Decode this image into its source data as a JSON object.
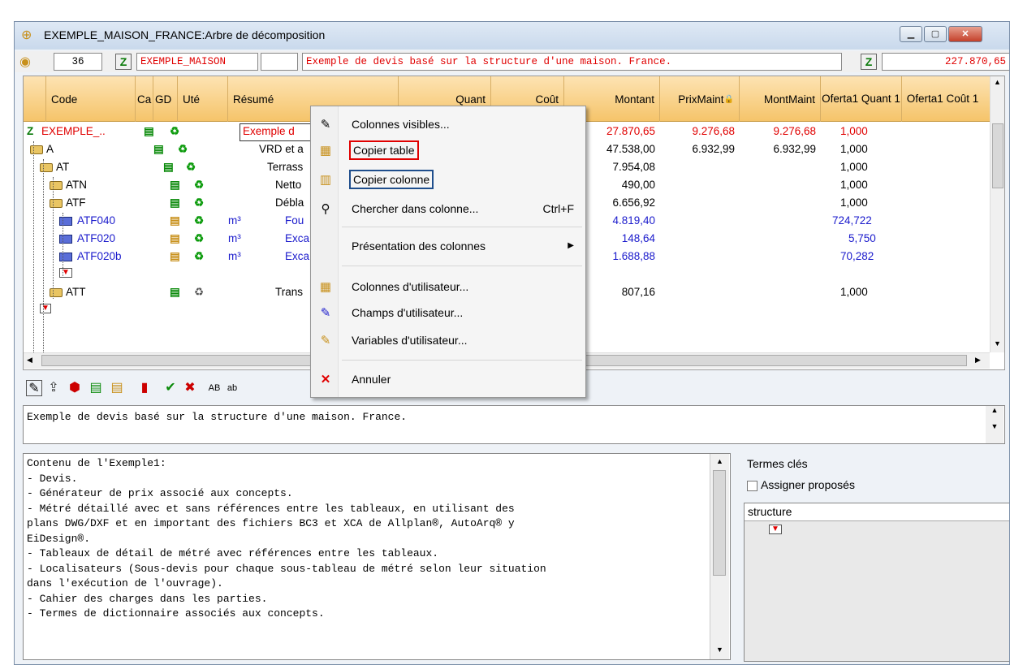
{
  "window": {
    "title": "EXEMPLE_MAISON_FRANCE:Arbre de décomposition",
    "min_label": "▁",
    "max_label": "▢",
    "close_label": "✕"
  },
  "topbar": {
    "count": "36",
    "code": "EXEMPLE_MAISON",
    "summary": "Exemple de devis basé sur la structure d'une maison. France.",
    "total": "227.870,65"
  },
  "grid": {
    "headers": {
      "code": "Code",
      "ca": "Ca",
      "gd": "GD",
      "ute": "Uté",
      "resume": "Résumé",
      "quant": "Quant",
      "cout": "Coût",
      "montant": "Montant",
      "prixmaint": "PrixMaint",
      "montmaint": "MontMaint",
      "oferta_quant": "Oferta1 Quant 1",
      "oferta_cout": "Oferta1 Coût 1"
    },
    "rows": [
      {
        "code": "EXEMPLE_..",
        "ute": "",
        "resume": "Exemple d",
        "montant": "27.870,65",
        "prixmaint": "9.276,68",
        "montmaint": "9.276,68",
        "oferta": "1,000"
      },
      {
        "code": "A",
        "ute": "",
        "resume": "VRD et a",
        "montant": "47.538,00",
        "prixmaint": "6.932,99",
        "montmaint": "6.932,99",
        "oferta": "1,000"
      },
      {
        "code": "AT",
        "ute": "",
        "resume": "Terrass",
        "montant": "7.954,08",
        "prixmaint": "",
        "montmaint": "",
        "oferta": "1,000"
      },
      {
        "code": "ATN",
        "ute": "",
        "resume": "Netto",
        "montant": "490,00",
        "prixmaint": "",
        "montmaint": "",
        "oferta": "1,000"
      },
      {
        "code": "ATF",
        "ute": "",
        "resume": "Débla",
        "montant": "6.656,92",
        "prixmaint": "",
        "montmaint": "",
        "oferta": "1,000"
      },
      {
        "code": "ATF040",
        "ute": "m³",
        "resume": "Fou",
        "montant": "4.819,40",
        "prixmaint": "",
        "montmaint": "",
        "oferta": "724,722"
      },
      {
        "code": "ATF020",
        "ute": "m³",
        "resume": "Exca",
        "montant": "148,64",
        "prixmaint": "",
        "montmaint": "",
        "oferta": "5,750"
      },
      {
        "code": "ATF020b",
        "ute": "m³",
        "resume": "Exca",
        "montant": "1.688,88",
        "prixmaint": "",
        "montmaint": "",
        "oferta": "70,282"
      },
      {
        "code": "",
        "ute": "",
        "resume": "",
        "montant": "",
        "prixmaint": "",
        "montmaint": "",
        "oferta": ""
      },
      {
        "code": "ATT",
        "ute": "",
        "resume": "Trans",
        "montant": "807,16",
        "prixmaint": "",
        "montmaint": "",
        "oferta": "1,000"
      }
    ]
  },
  "toolbar2": {
    "ab_label": "AB",
    "ab2_label": "ab"
  },
  "summary_text": "Exemple de devis basé sur la structure d'une maison. France.",
  "content_lines": [
    "Contenu de l'Exemple1:",
    "- Devis.",
    "- Générateur de prix associé aux concepts.",
    "- Métré détaillé avec et sans références entre les tableaux, en utilisant des",
    "plans DWG/DXF et en important des fichiers BC3 et XCA de Allplan®, AutoArq® y",
    "EiDesign®.",
    "- Tableaux de détail de métré avec références entre les tableaux.",
    "- Localisateurs (Sous-devis pour chaque sous-tableau de métré selon leur situation",
    "dans l'exécution de l'ouvrage).",
    "- Cahier des charges dans les parties.",
    "- Termes de dictionnaire associés aux concepts."
  ],
  "keywords": {
    "title": "Termes clés",
    "assign_label": "Assigner proposés",
    "field": "structure"
  },
  "context_menu": {
    "items": [
      {
        "label": "Colonnes visibles...",
        "shortcut": "",
        "icon": "columns-visible-icon"
      },
      {
        "label": "Copier table",
        "shortcut": "",
        "icon": "copy-table-icon"
      },
      {
        "label": "Copier colonne",
        "shortcut": "",
        "icon": "copy-column-icon"
      },
      {
        "label": "Chercher dans colonne...",
        "shortcut": "Ctrl+F",
        "icon": "binoculars-icon"
      },
      {
        "label": "Présentation des colonnes",
        "shortcut": "",
        "icon": ""
      },
      {
        "label": "Colonnes d'utilisateur...",
        "shortcut": "",
        "icon": "user-columns-icon"
      },
      {
        "label": "Champs d'utilisateur...",
        "shortcut": "",
        "icon": "user-fields-icon"
      },
      {
        "label": "Variables d'utilisateur...",
        "shortcut": "",
        "icon": "user-variables-icon"
      },
      {
        "label": "Annuler",
        "shortcut": "",
        "icon": "cancel-icon"
      }
    ]
  },
  "colors": {
    "accent_red": "#e00000",
    "header_orange": "#f5c46a",
    "link_blue": "#1a1acc"
  }
}
